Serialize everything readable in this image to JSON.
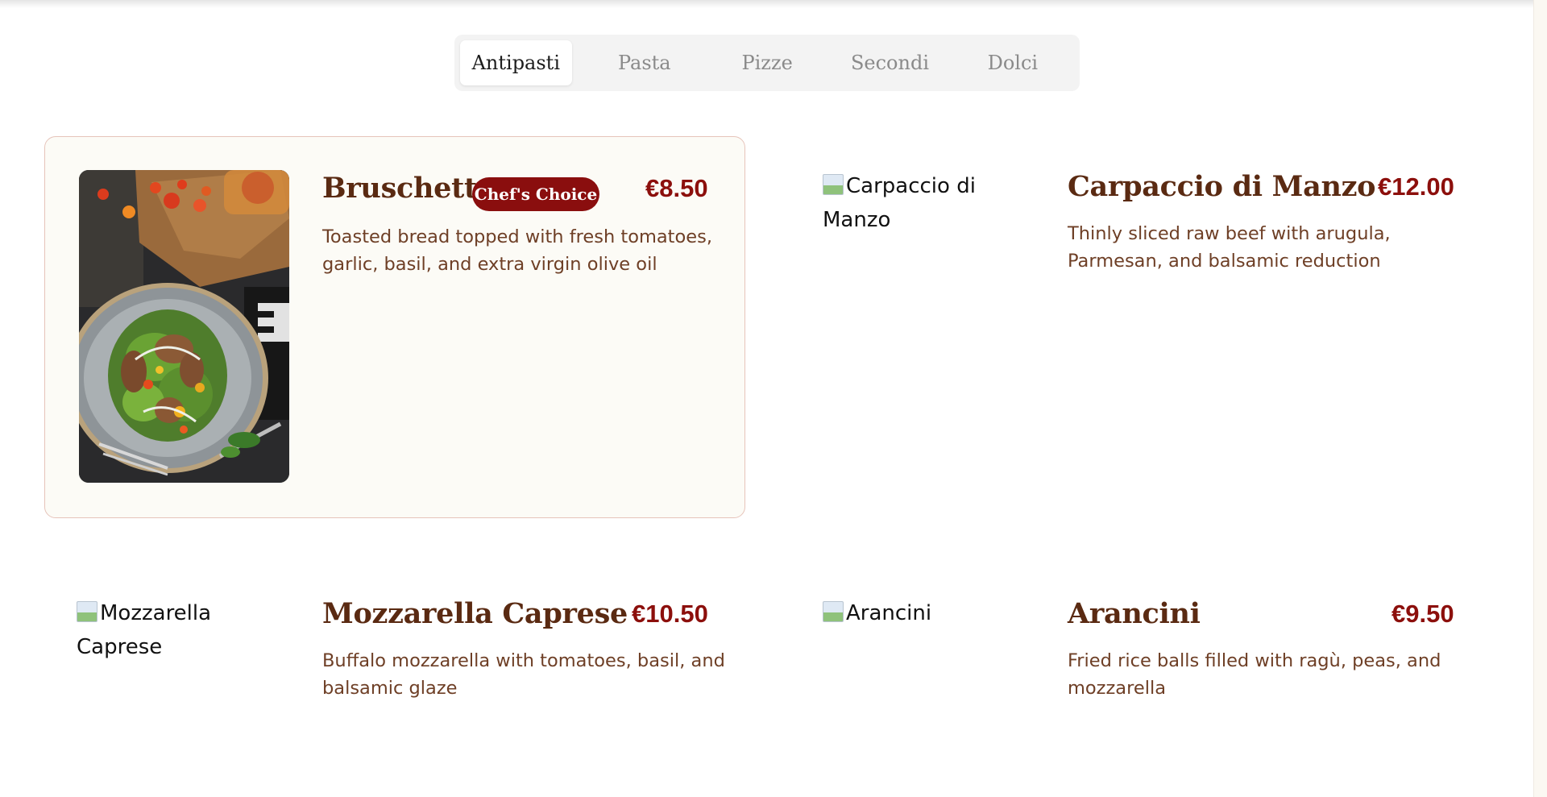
{
  "tabs": [
    {
      "label": "Antipasti",
      "active": true
    },
    {
      "label": "Pasta",
      "active": false
    },
    {
      "label": "Pizze",
      "active": false
    },
    {
      "label": "Secondi",
      "active": false
    },
    {
      "label": "Dolci",
      "active": false
    }
  ],
  "dishes": [
    {
      "name": "Bruschetta",
      "badge": "Chef's Choice",
      "price": "€8.50",
      "description": "Toasted bread topped with fresh tomatoes, garlic, basil, and extra virgin olive oil"
    },
    {
      "name": "Carpaccio di Manzo",
      "price": "€12.00",
      "image_alt": "Carpaccio di Manzo",
      "description": "Thinly sliced raw beef with arugula, Parmesan, and balsamic reduction"
    },
    {
      "name": "Mozzarella Caprese",
      "price": "€10.50",
      "image_alt": "Mozzarella Caprese",
      "description": "Buffalo mozzarella with tomatoes, basil, and balsamic glaze"
    },
    {
      "name": "Arancini",
      "price": "€9.50",
      "image_alt": "Arancini",
      "description": "Fried rice balls filled with ragù, peas, and mozzarella"
    }
  ],
  "colors": {
    "dish_name": "#5a2a12",
    "price": "#8c0f0c",
    "description": "#6e3f26",
    "badge_bg": "#8a0e0e",
    "featured_border": "#e6c4ba",
    "featured_bg": "#fcfbf6"
  }
}
